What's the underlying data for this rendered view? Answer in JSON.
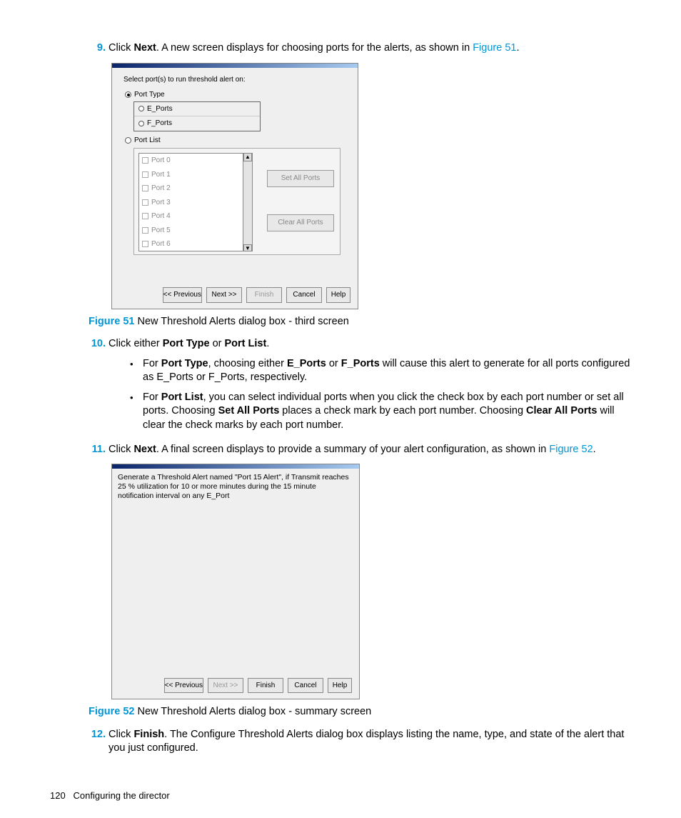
{
  "steps": {
    "s9": {
      "num": "9.",
      "pre": "Click ",
      "b": "Next",
      "post": ". A new screen displays for choosing ports for the alerts, as shown in ",
      "link": "Figure 51",
      "end": "."
    },
    "s10": {
      "num": "10.",
      "pre": "Click either ",
      "b1": "Port Type",
      "mid": " or ",
      "b2": "Port List",
      "end": "."
    },
    "s10a": {
      "pre": "For ",
      "b1": "Port Type",
      "mid1": ", choosing either ",
      "b2": "E_Ports",
      "mid2": " or ",
      "b3": "F_Ports",
      "post": " will cause this alert to generate for all ports configured as E_Ports or F_Ports, respectively."
    },
    "s10b": {
      "pre": "For ",
      "b1": "Port List",
      "mid1": ", you can select individual ports when you click the check box by each port number or set all ports. Choosing ",
      "b2": "Set All Ports",
      "mid2": " places a check mark by each port number. Choosing ",
      "b3": "Clear All Ports",
      "post": " will clear the check marks by each port number."
    },
    "s11": {
      "num": "11.",
      "pre": "Click ",
      "b": "Next",
      "post": ". A final screen displays to provide a summary of your alert configuration, as shown in ",
      "link": "Figure 52",
      "end": "."
    },
    "s12": {
      "num": "12.",
      "pre": "Click ",
      "b": "Finish",
      "post": ". The Configure Threshold Alerts dialog box displays listing the name, type, and state of the alert that you just configured."
    }
  },
  "fig51": {
    "label": "Figure 51",
    "caption": " New Threshold Alerts dialog box - third screen"
  },
  "fig52": {
    "label": "Figure 52",
    "caption": " New Threshold Alerts dialog box - summary screen"
  },
  "dialog1": {
    "headline": "Select port(s) to run threshold alert on:",
    "portType": "Port Type",
    "eports": "E_Ports",
    "fports": "F_Ports",
    "portList": "Port List",
    "ports": [
      "Port 0",
      "Port 1",
      "Port 2",
      "Port 3",
      "Port 4",
      "Port 5",
      "Port 6"
    ],
    "setAll": "Set All Ports",
    "clearAll": "Clear All Ports",
    "buttons": {
      "prev": "<< Previous",
      "next": "Next >>",
      "finish": "Finish",
      "cancel": "Cancel",
      "help": "Help"
    }
  },
  "dialog2": {
    "summary": "Generate a Threshold Alert named \"Port 15 Alert\",  if Transmit reaches 25 % utilization for 10 or more minutes during the 15 minute notification interval on any E_Port",
    "buttons": {
      "prev": "<< Previous",
      "next": "Next >>",
      "finish": "Finish",
      "cancel": "Cancel",
      "help": "Help"
    }
  },
  "footer": {
    "page": "120",
    "section": "Configuring the director"
  }
}
